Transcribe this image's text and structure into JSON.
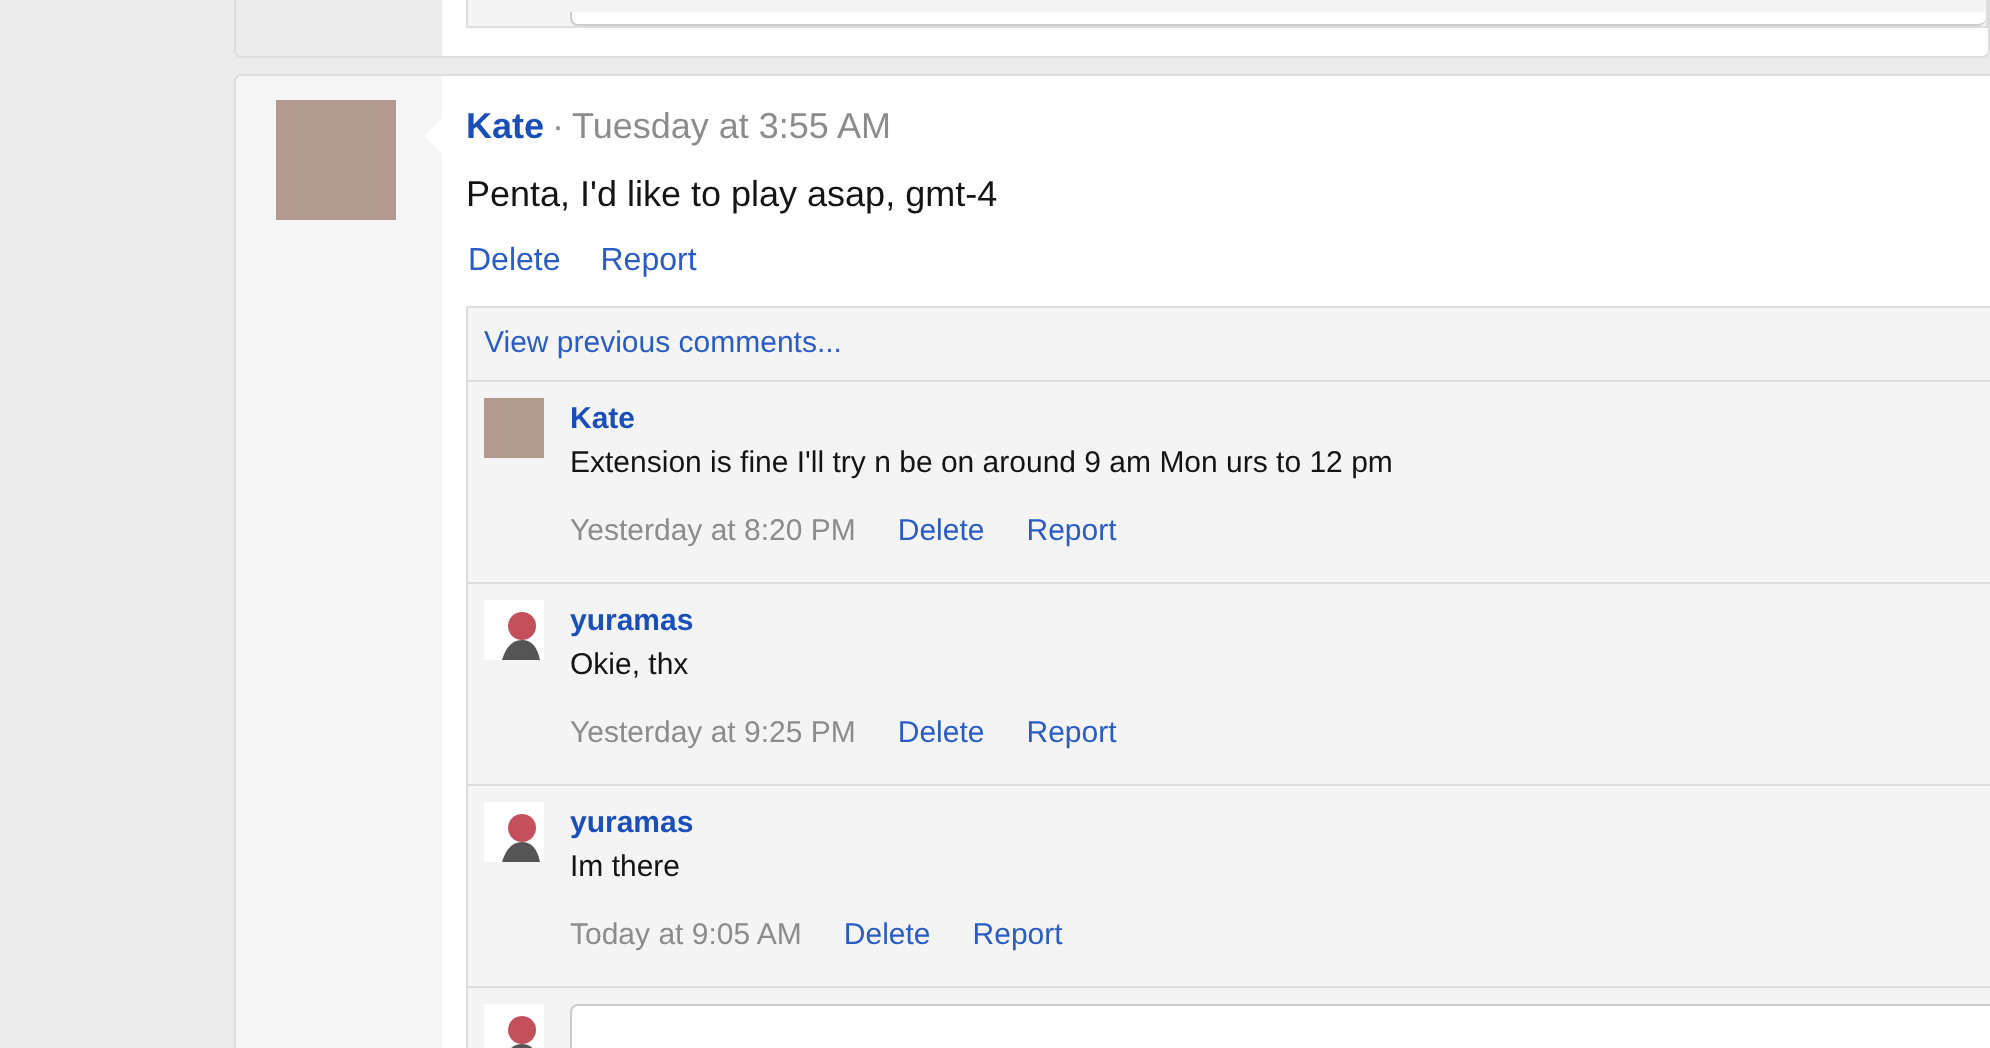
{
  "post": {
    "author": "Kate",
    "separator": "·",
    "time": "Tuesday at 3:55 AM",
    "text": "Penta, I'd like to play asap, gmt-4",
    "actions": [
      "Delete",
      "Report"
    ]
  },
  "view_previous": "View previous comments...",
  "comments": [
    {
      "author": "Kate",
      "text": "Extension is fine I'll try n be on around 9 am Mon urs to 12 pm",
      "time": "Yesterday at 8:20 PM",
      "actions": [
        "Delete",
        "Report"
      ]
    },
    {
      "author": "yuramas",
      "text": "Okie, thx",
      "time": "Yesterday at 9:25 PM",
      "actions": [
        "Delete",
        "Report"
      ]
    },
    {
      "author": "yuramas",
      "text": "Im there",
      "time": "Today at 9:05 AM",
      "actions": [
        "Delete",
        "Report"
      ]
    }
  ]
}
